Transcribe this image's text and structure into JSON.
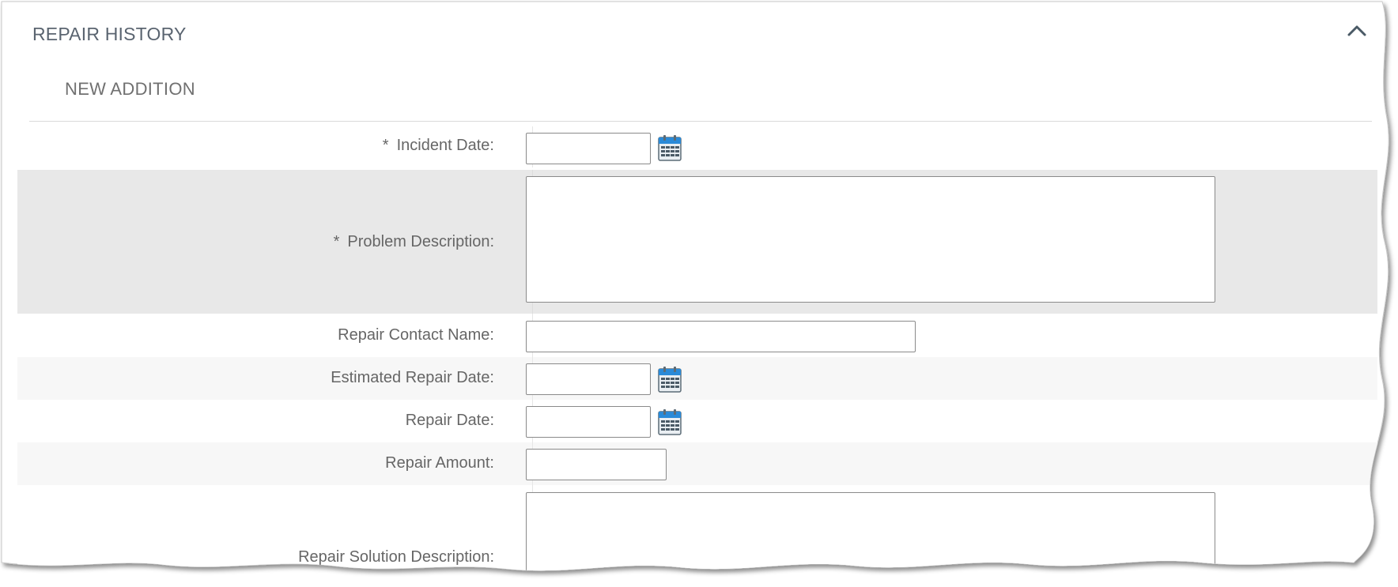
{
  "section": {
    "title": "REPAIR HISTORY",
    "collapse_icon": "chevron-up-icon"
  },
  "subsection": {
    "title": "NEW ADDITION"
  },
  "form": {
    "fields": [
      {
        "label": "Incident Date:",
        "required": true,
        "type": "date",
        "value": "",
        "icon": "calendar-icon"
      },
      {
        "label": "Problem Description:",
        "required": true,
        "type": "textarea",
        "value": ""
      },
      {
        "label": "Repair Contact Name:",
        "required": false,
        "type": "text",
        "value": ""
      },
      {
        "label": "Estimated Repair Date:",
        "required": false,
        "type": "date",
        "value": "",
        "icon": "calendar-icon"
      },
      {
        "label": "Repair Date:",
        "required": false,
        "type": "date",
        "value": "",
        "icon": "calendar-icon"
      },
      {
        "label": "Repair Amount:",
        "required": false,
        "type": "text",
        "value": ""
      },
      {
        "label": "Repair Solution Description:",
        "required": false,
        "type": "textarea",
        "value": ""
      }
    ],
    "required_marker": "*"
  },
  "colors": {
    "row_highlight": "#e8e8e8",
    "row_alt": "#f7f7f7",
    "calendar_accent": "#2a8ad8"
  }
}
